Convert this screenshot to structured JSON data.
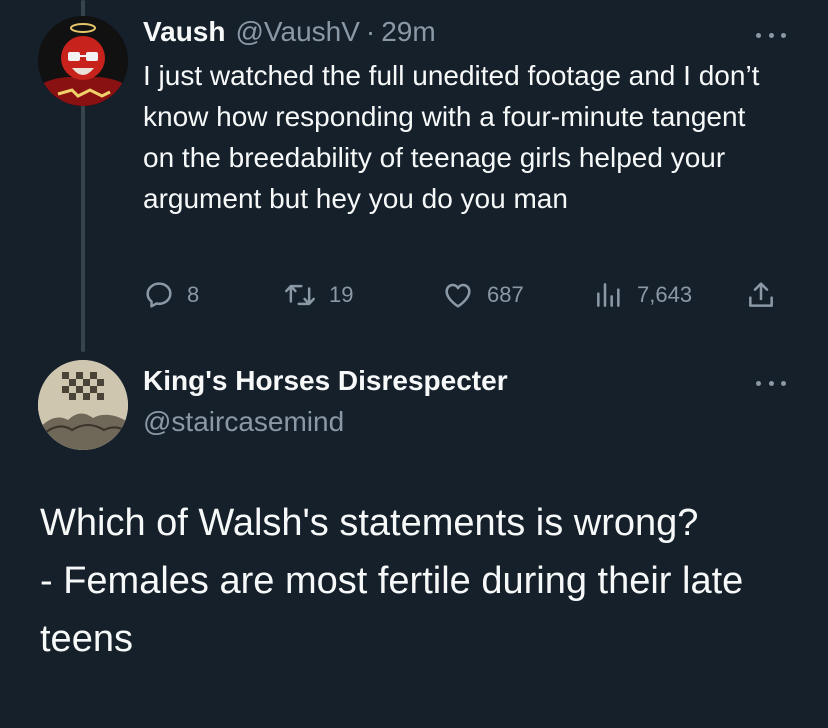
{
  "tweet1": {
    "display_name": "Vaush",
    "handle": "@VaushV",
    "separator": "·",
    "time": "29m",
    "text": "I just watched the full unedited footage and I don’t know how responding with a four-minute tangent on the breedability of teenage girls helped your argument but hey you do you man",
    "replies": "8",
    "retweets": "19",
    "likes": "687",
    "views": "7,643",
    "icons": {
      "avatar": "avatar-image",
      "more": "more-icon",
      "reply": "reply-icon",
      "retweet": "retweet-icon",
      "like": "heart-icon",
      "views": "views-icon",
      "share": "share-icon"
    }
  },
  "tweet2": {
    "display_name": "King's Horses Disrespecter",
    "handle": "@staircasemind",
    "text_lines": [
      "Which of Walsh's statements is wrong?",
      "- Females are most fertile during their late teens"
    ]
  },
  "colors": {
    "background": "#15202b",
    "text_primary": "#f7f9f9",
    "text_secondary": "#8b98a5",
    "thread_line": "#38444d"
  }
}
